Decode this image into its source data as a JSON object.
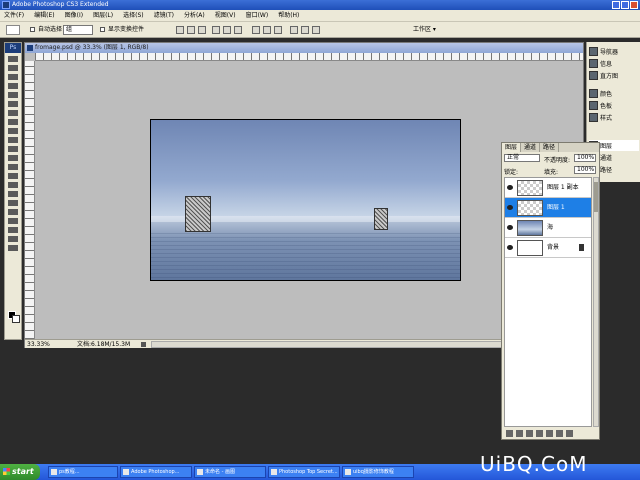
{
  "app": {
    "title": "Adobe Photoshop CS3 Extended"
  },
  "menu": [
    "文件(F)",
    "编辑(E)",
    "图像(I)",
    "图层(L)",
    "选择(S)",
    "滤镜(T)",
    "分析(A)",
    "视图(V)",
    "窗口(W)",
    "帮助(H)"
  ],
  "options": {
    "auto_select": "自动选择",
    "auto_select_target": "组",
    "show_transform": "显示变换控件",
    "workspace": "工作区 ▾"
  },
  "document": {
    "title": "fromage.psd @ 33.3% (图层 1, RGB/8)",
    "zoom": "33.33%",
    "doc_info": "文档:6.18M/15.3M"
  },
  "dock": [
    "导航器",
    "信息",
    "直方图",
    "颜色",
    "色板",
    "样式",
    "图层",
    "通道",
    "路径"
  ],
  "layers_panel": {
    "tabs": [
      "图层",
      "通道",
      "路径"
    ],
    "blend_mode": "正常",
    "opacity_label": "不透明度:",
    "opacity": "100%",
    "lock_label": "锁定:",
    "fill_label": "填充:",
    "fill": "100%",
    "layers": [
      {
        "name": "图层 1 副本",
        "thumb": "checker",
        "selected": false,
        "locked": false
      },
      {
        "name": "图层 1",
        "thumb": "checker",
        "selected": true,
        "locked": false
      },
      {
        "name": "海",
        "thumb": "sky",
        "selected": false,
        "locked": false
      },
      {
        "name": "背景",
        "thumb": "white",
        "selected": false,
        "locked": true
      }
    ]
  },
  "taskbar": {
    "start": "start",
    "items": [
      "ps教程...",
      "Adobe Photoshop...",
      "未命名 - 画图",
      "Photoshop Top Secret...",
      "uibq摄影修饰教程"
    ]
  },
  "watermark": "UiBQ.CoM"
}
